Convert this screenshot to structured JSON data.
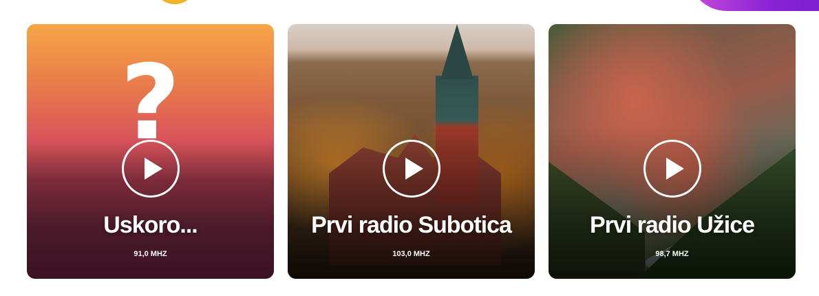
{
  "stations": [
    {
      "name": "Uskoro...",
      "frequency": "91,0 MHZ",
      "image": "question-mark-placeholder",
      "placeholder_glyph": "?",
      "accent": "#e06a52"
    },
    {
      "name": "Prvi radio Subotica",
      "frequency": "103,0 MHZ",
      "image": "subotica-city-hall-aerial",
      "accent": "#b76a1e"
    },
    {
      "name": "Prvi radio Užice",
      "frequency": "98,7 MHZ",
      "image": "uzice-city-aerial",
      "accent": "#c9644c"
    }
  ],
  "play_icon": "play-icon",
  "decor": {
    "orb_color": "#f8c23a",
    "wave_color": "#8a22d6"
  }
}
